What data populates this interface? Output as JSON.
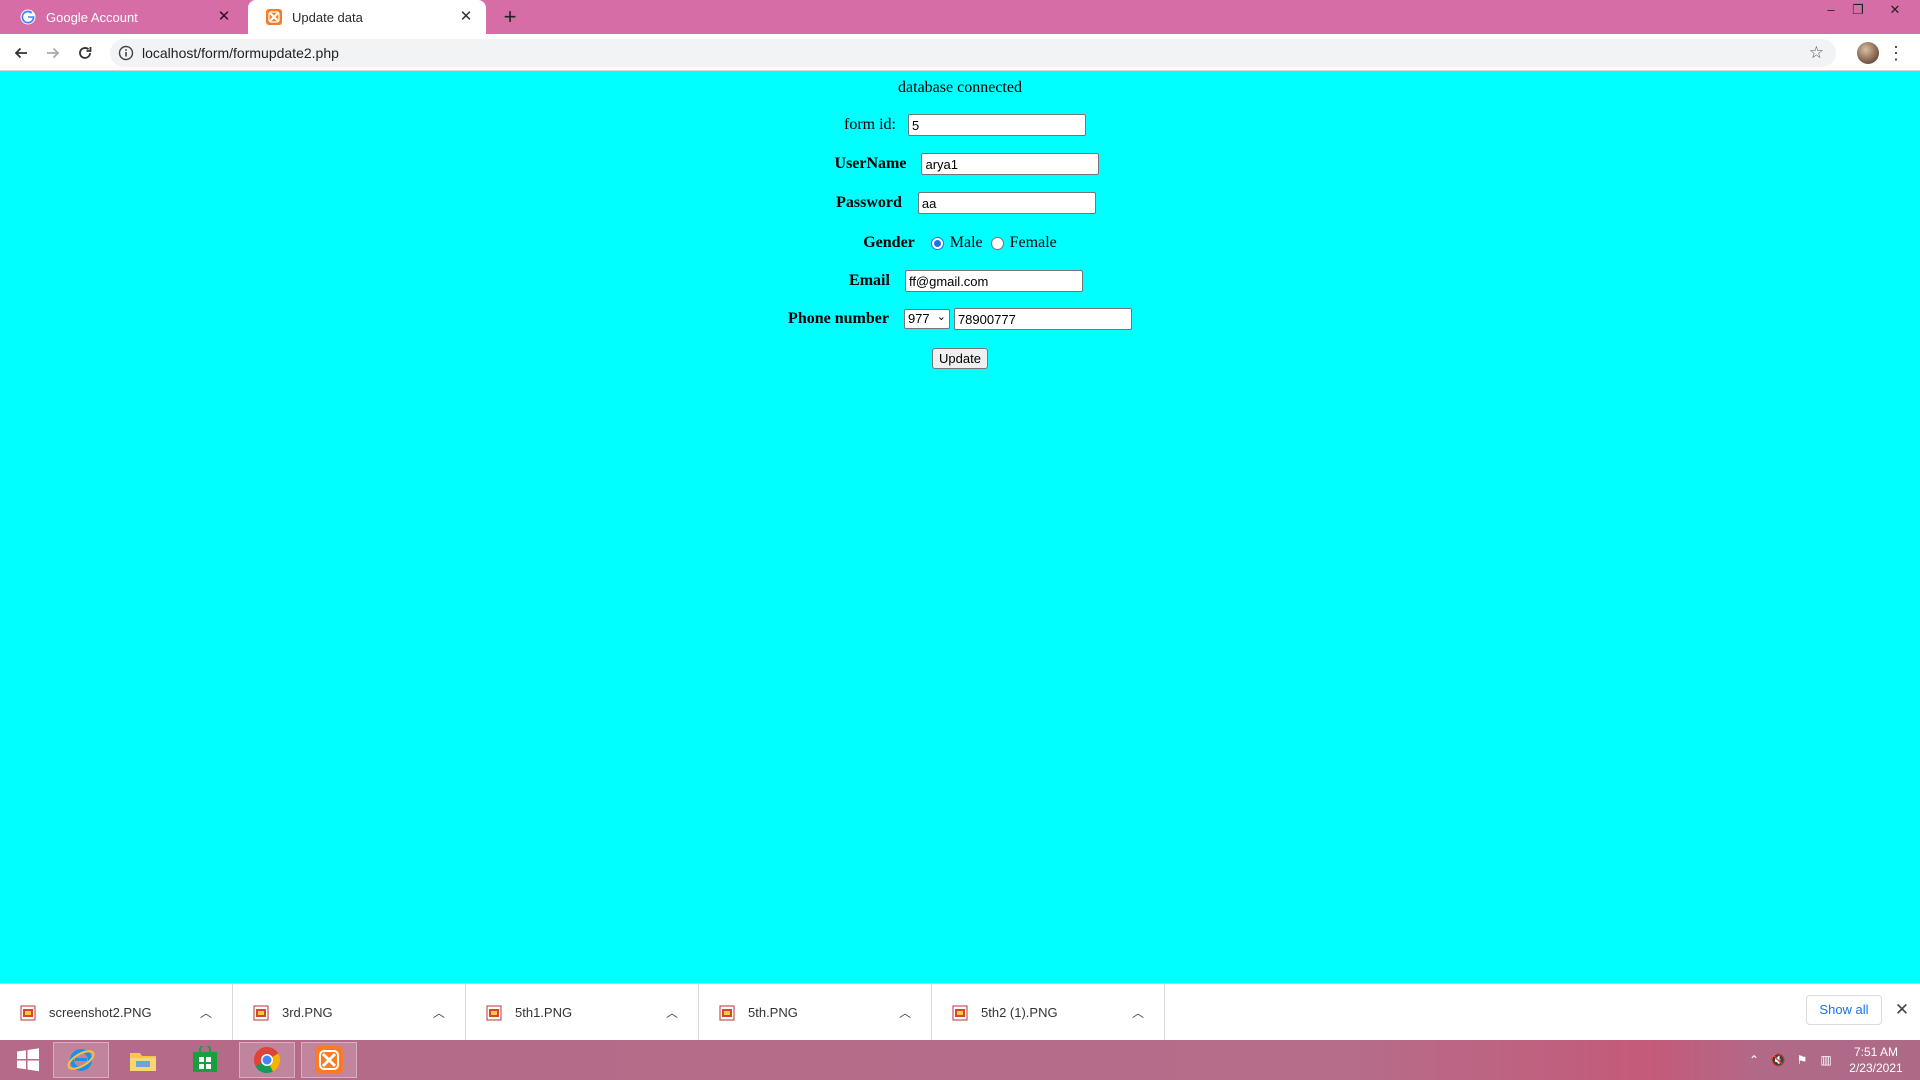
{
  "browser": {
    "tabs": [
      {
        "label": "Google Account",
        "active": false,
        "icon": "google-g-icon"
      },
      {
        "label": "Update data",
        "active": true,
        "icon": "xampp-icon"
      }
    ],
    "new_tab_symbol": "+",
    "window_controls": {
      "minimize": "–",
      "restore": "❐",
      "close": "✕"
    },
    "url": "localhost/form/formupdate2.php",
    "nav_icons": [
      "back-arrow-icon",
      "forward-arrow-icon",
      "reload-icon",
      "info-icon",
      "star-icon",
      "menu-dots-icon"
    ]
  },
  "page": {
    "background_color": "#00ffff",
    "status": "database connected",
    "form": {
      "form_id_label": "form id:",
      "form_id_value": "5",
      "username_label": "UserName",
      "username_value": "arya1",
      "password_label": "Password",
      "password_value": "aa",
      "gender_label": "Gender",
      "gender_options": [
        {
          "label": "Male",
          "checked": true
        },
        {
          "label": "Female",
          "checked": false
        }
      ],
      "email_label": "Email",
      "email_value": "ff@gmail.com",
      "phone_label": "Phone number",
      "phone_code_selected": "977",
      "phone_value": "78900777",
      "update_button": "Update"
    }
  },
  "downloads": {
    "items": [
      {
        "name": "screenshot2.PNG"
      },
      {
        "name": "3rd.PNG"
      },
      {
        "name": "5th1.PNG"
      },
      {
        "name": "5th.PNG"
      },
      {
        "name": "5th2 (1).PNG"
      }
    ],
    "show_all": "Show all",
    "close_symbol": "✕"
  },
  "taskbar": {
    "apps": [
      "windows-start-icon",
      "internet-explorer-icon",
      "file-explorer-icon",
      "store-icon",
      "chrome-icon",
      "xampp-icon"
    ],
    "clock_time": "7:51 AM",
    "clock_date": "2/23/2021"
  }
}
